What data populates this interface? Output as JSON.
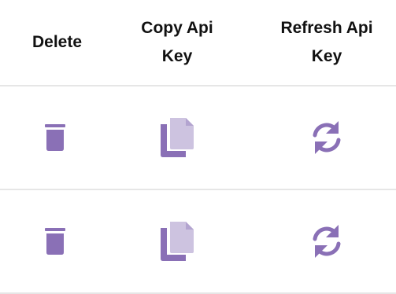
{
  "table": {
    "headers": {
      "delete": "Delete",
      "copy_line1": "Copy Api",
      "copy_line2": "Key",
      "refresh_line1": "Refresh Api",
      "refresh_line2": "Key"
    },
    "rows": [
      {
        "icons": [
          "trash-icon",
          "copy-icon",
          "refresh-icon"
        ]
      },
      {
        "icons": [
          "trash-icon",
          "copy-icon",
          "refresh-icon"
        ]
      }
    ]
  },
  "colors": {
    "accent": "#8a70b6",
    "accent_light": "#cdc3e0",
    "divider": "#e6e6e6"
  }
}
